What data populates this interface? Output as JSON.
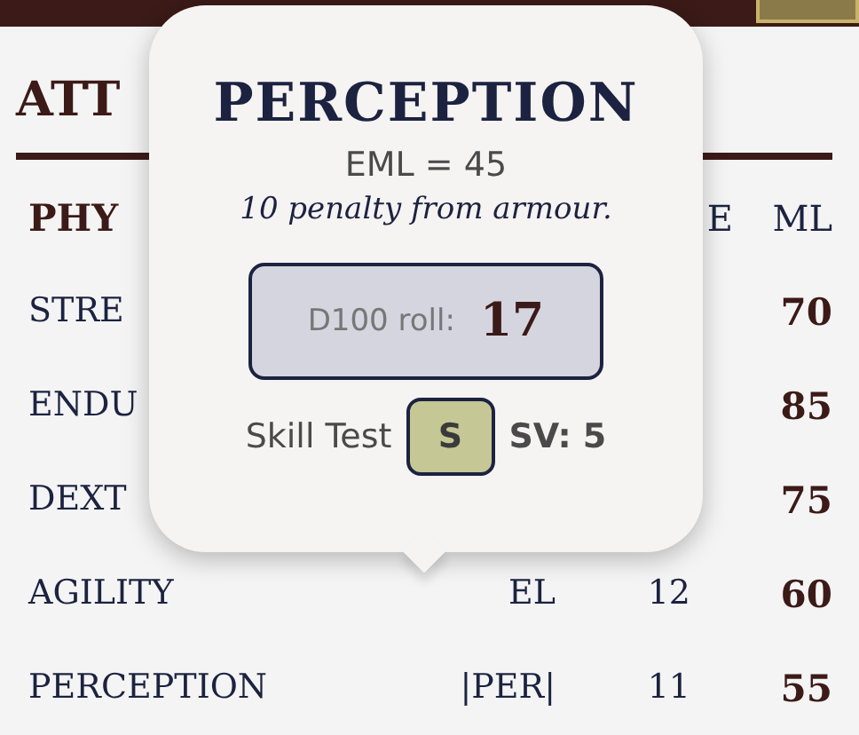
{
  "section": {
    "heading": "ATT"
  },
  "table": {
    "group": "PHY",
    "columns": [
      "E",
      "ML"
    ],
    "rows": [
      {
        "name": "STRE",
        "ml": "70"
      },
      {
        "name": "ENDU",
        "ml": "85"
      },
      {
        "name": "DEXT",
        "ml": "75"
      },
      {
        "name": "AGILITY",
        "abbr": "EL",
        "value": "12",
        "ml": "60"
      },
      {
        "name": "PERCEPTION",
        "abbr": "|PER|",
        "value": "11",
        "ml": "55"
      }
    ]
  },
  "popover": {
    "title": "PERCEPTION",
    "eml": "EML = 45",
    "note": "10 penalty from armour.",
    "roll_label": "D100 roll:",
    "roll_value": "17",
    "test_label": "Skill Test",
    "result": "S",
    "sv": "SV: 5"
  }
}
